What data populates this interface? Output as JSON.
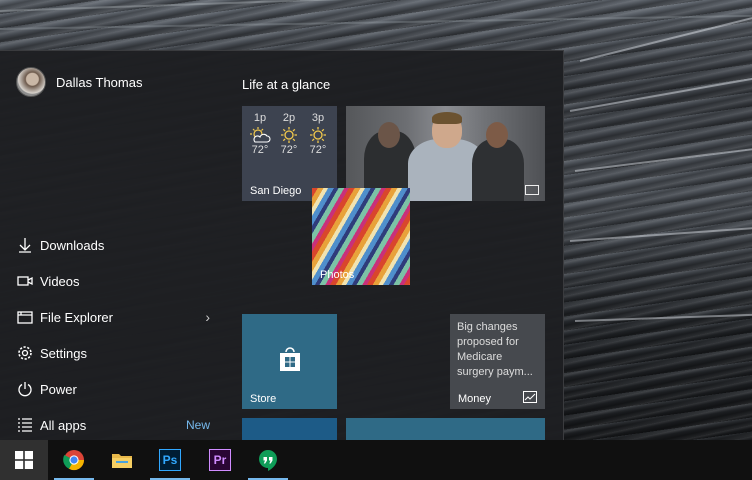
{
  "user": {
    "name": "Dallas Thomas"
  },
  "menu": {
    "items": [
      {
        "label": "Downloads",
        "icon": "download-icon"
      },
      {
        "label": "Videos",
        "icon": "video-icon"
      },
      {
        "label": "File Explorer",
        "icon": "file-explorer-icon",
        "has_submenu": true
      },
      {
        "label": "Settings",
        "icon": "gear-icon"
      },
      {
        "label": "Power",
        "icon": "power-icon"
      },
      {
        "label": "All apps",
        "icon": "all-apps-icon",
        "badge": "New"
      }
    ]
  },
  "tiles": {
    "group_title": "Life at a glance",
    "weather": {
      "location": "San Diego",
      "forecast": [
        {
          "time": "1p",
          "temp": "72°",
          "icon": "partly-sunny-icon"
        },
        {
          "time": "2p",
          "temp": "72°",
          "icon": "sun-icon"
        },
        {
          "time": "3p",
          "temp": "72°",
          "icon": "sun-icon"
        }
      ]
    },
    "photos": {
      "label": "Photos"
    },
    "store": {
      "label": "Store"
    },
    "money": {
      "headline": "Big changes proposed for Medicare surgery paym...",
      "label": "Money"
    }
  },
  "taskbar": {
    "apps": [
      {
        "name": "Google Chrome",
        "icon": "chrome-icon"
      },
      {
        "name": "File Explorer",
        "icon": "folder-icon"
      },
      {
        "name": "Photoshop",
        "text": "Ps"
      },
      {
        "name": "Premiere",
        "text": "Pr"
      },
      {
        "name": "Hangouts",
        "icon": "hangouts-icon"
      }
    ]
  },
  "colors": {
    "accent": "#76b9ed",
    "store_tile": "#2f6a86",
    "menu_bg": "#1e1f22"
  }
}
